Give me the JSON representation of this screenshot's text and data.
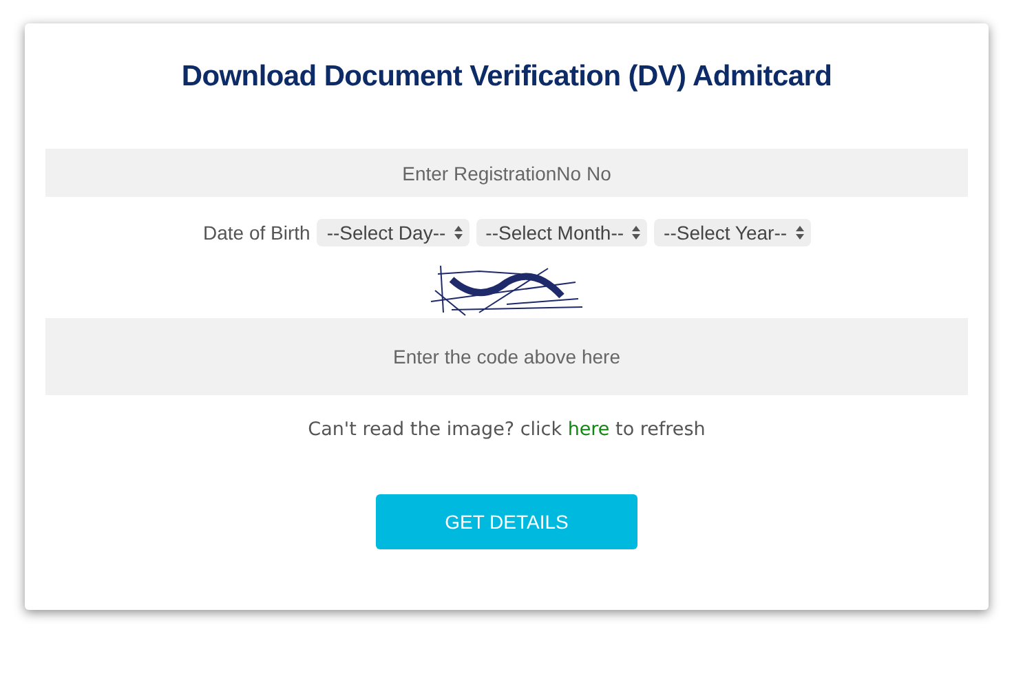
{
  "title": "Download Document Verification (DV) Admitcard",
  "registration": {
    "placeholder": "Enter RegistrationNo No"
  },
  "dob": {
    "label": "Date of Birth",
    "selects": [
      "--Select Day--",
      "--Select Month--",
      "--Select Year--"
    ]
  },
  "code": {
    "placeholder": "Enter the code above here"
  },
  "refresh": {
    "before": "Can't read the image? click",
    "link": "here",
    "after": "to refresh"
  },
  "button": "GET DETAILS"
}
